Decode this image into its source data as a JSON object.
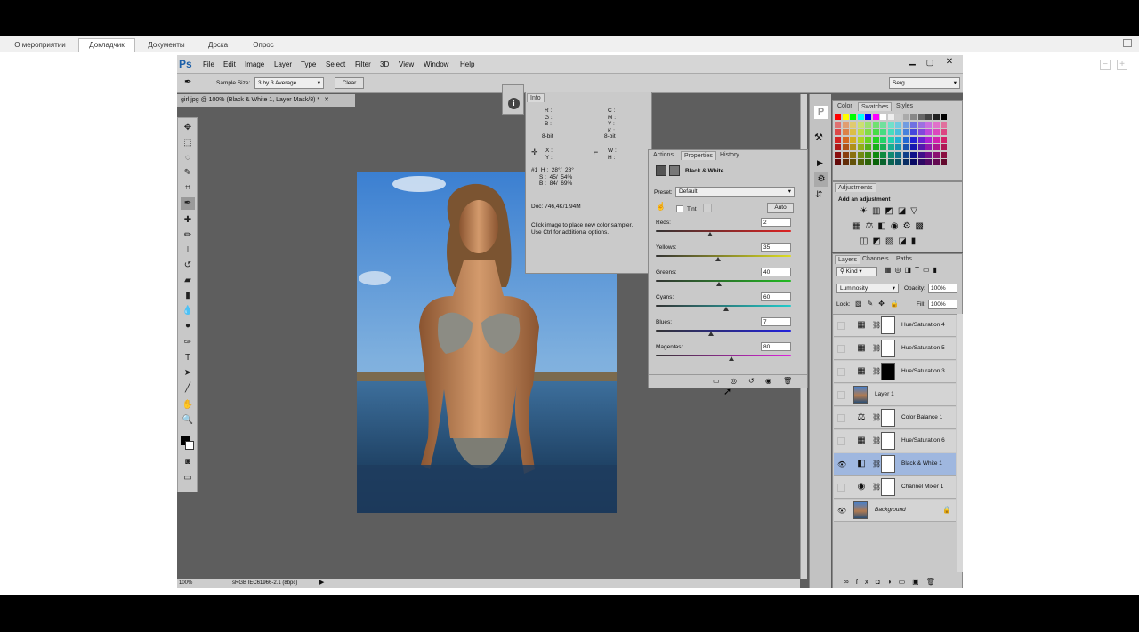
{
  "outer_tabs": [
    "О мероприятии",
    "Докладчик",
    "Документы",
    "Доска",
    "Опрос"
  ],
  "ps": {
    "logo": "Ps",
    "menu": [
      "File",
      "Edit",
      "Image",
      "Layer",
      "Type",
      "Select",
      "Filter",
      "3D",
      "View",
      "Window",
      "Help"
    ],
    "options": {
      "sample_size_label": "Sample Size:",
      "sample_size_value": "3 by 3 Average",
      "clear_label": "Clear",
      "workspace": "Serg"
    },
    "doc_tab": "girl.jpg @ 100% (Black & White 1, Layer Mask/8) *",
    "status": {
      "zoom": "100%",
      "profile": "sRGB IEC61966-2.1 (8bpc)"
    },
    "info": {
      "title": "Info",
      "rgb": "R :\nG :\nB :",
      "cmyk": "C :\nM :\nY :\nK :",
      "bit1": "8-bit",
      "bit2": "8-bit",
      "xy": "X :\nY :",
      "wh": "W :\nH :",
      "sampler": "#1  H :  28°/  28°\n     S :  45/  54%\n     B :  84/  69%",
      "doc": "Doc: 746,4K/1,94M",
      "hint": "Click image to place new color sampler.\nUse Ctrl for additional options."
    },
    "properties": {
      "tabs": [
        "Actions",
        "Properties",
        "History"
      ],
      "title": "Black & White",
      "preset_label": "Preset:",
      "preset_value": "Default",
      "tint_label": "Tint",
      "auto_label": "Auto",
      "sliders": [
        {
          "label": "Reds:",
          "value": "2",
          "pos": 0.4,
          "grad": "linear-gradient(to right,#333,#d22)"
        },
        {
          "label": "Yellows:",
          "value": "35",
          "pos": 0.46,
          "grad": "linear-gradient(to right,#333,#dd2)"
        },
        {
          "label": "Greens:",
          "value": "40",
          "pos": 0.47,
          "grad": "linear-gradient(to right,#333,#2b2)"
        },
        {
          "label": "Cyans:",
          "value": "60",
          "pos": 0.52,
          "grad": "linear-gradient(to right,#333,#2cc)"
        },
        {
          "label": "Blues:",
          "value": "7",
          "pos": 0.41,
          "grad": "linear-gradient(to right,#333,#22d)"
        },
        {
          "label": "Magentas:",
          "value": "80",
          "pos": 0.56,
          "grad": "linear-gradient(to right,#333,#d2d)"
        }
      ]
    },
    "color_panel": {
      "tabs": [
        "Color",
        "Swatches",
        "Styles"
      ]
    },
    "adjustments": {
      "title": "Adjustments",
      "subtitle": "Add an adjustment"
    },
    "layers": {
      "tabs": [
        "Layers",
        "Channels",
        "Paths"
      ],
      "filter": "Kind",
      "blend": "Luminosity",
      "opacity_label": "Opacity:",
      "opacity": "100%",
      "lock_label": "Lock:",
      "fill_label": "Fill:",
      "fill": "100%",
      "items": [
        {
          "name": "Hue/Saturation 4",
          "visible": false,
          "selected": false,
          "icon": "▦",
          "mask": "white"
        },
        {
          "name": "Hue/Saturation 5",
          "visible": false,
          "selected": false,
          "icon": "▦",
          "mask": "white"
        },
        {
          "name": "Hue/Saturation 3",
          "visible": false,
          "selected": false,
          "icon": "▦",
          "mask": "black"
        },
        {
          "name": "Layer 1",
          "visible": false,
          "selected": false,
          "icon": "",
          "mask": "none"
        },
        {
          "name": "Color Balance 1",
          "visible": false,
          "selected": false,
          "icon": "⚖",
          "mask": "white"
        },
        {
          "name": "Hue/Saturation 6",
          "visible": false,
          "selected": false,
          "icon": "▦",
          "mask": "white"
        },
        {
          "name": "Black & White 1",
          "visible": true,
          "selected": true,
          "icon": "◧",
          "mask": "white"
        },
        {
          "name": "Channel Mixer 1",
          "visible": false,
          "selected": false,
          "icon": "◉",
          "mask": "white"
        },
        {
          "name": "Background",
          "visible": true,
          "selected": false,
          "icon": "",
          "mask": "none"
        }
      ]
    }
  }
}
